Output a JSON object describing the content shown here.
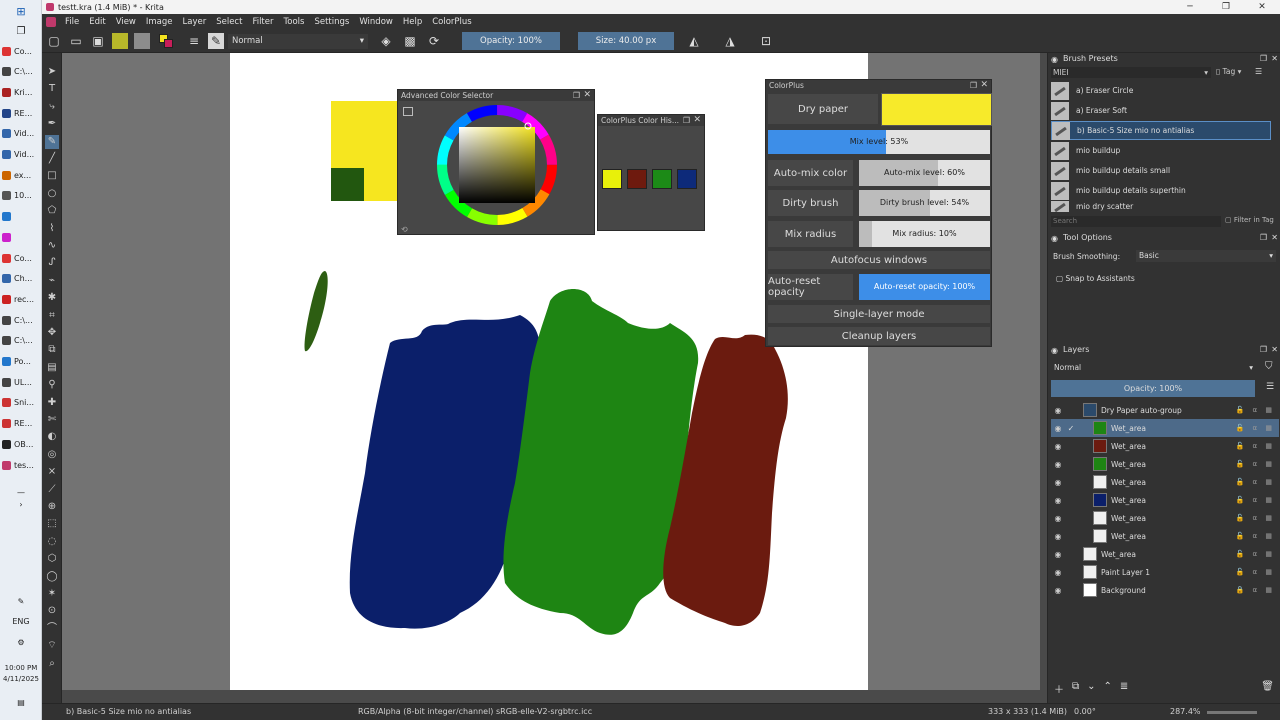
{
  "window": {
    "title": "testt.kra (1.4 MiB) * - Krita",
    "controls": [
      "─",
      "❐",
      "✕"
    ]
  },
  "taskbar": {
    "items": [
      "Co...",
      "C:\\...",
      "Kri...",
      "RE...",
      "Vid...",
      "Vid...",
      "ex...",
      "10...",
      "",
      "",
      "Co...",
      "Ch...",
      "rec...",
      "C:\\...",
      "C:\\...",
      "Po...",
      "UL...",
      "Sni...",
      "RE...",
      "OB...",
      "tes..."
    ],
    "lang": "ENG",
    "time": "10:00 PM",
    "date": "4/11/2025"
  },
  "menu": [
    "File",
    "Edit",
    "View",
    "Image",
    "Layer",
    "Select",
    "Filter",
    "Tools",
    "Settings",
    "Window",
    "Help",
    "ColorPlus"
  ],
  "toolbar": {
    "blend_mode": "Normal",
    "opacity": "Opacity: 100%",
    "size": "Size: 40.00 px"
  },
  "advanced_color_selector": {
    "title": "Advanced Color Selector"
  },
  "color_history": {
    "title": "ColorPlus Color His...",
    "swatches": [
      "#e8f00a",
      "#6e1a0e",
      "#1c8a17",
      "#0d2a7a"
    ]
  },
  "colorplus": {
    "title": "ColorPlus",
    "dry_paper": "Dry paper",
    "dry_color": "#f7ea2a",
    "mix_level": "Mix level: 53%",
    "mix_level_value": 0.53,
    "auto_mix_color": "Auto-mix color",
    "auto_mix_level": "Auto-mix level: 60%",
    "auto_mix_value": 0.6,
    "dirty_brush": "Dirty brush",
    "dirty_level": "Dirty brush level: 54%",
    "dirty_value": 0.54,
    "mix_radius": "Mix radius",
    "mix_radius_level": "Mix radius: 10%",
    "mix_radius_value": 0.1,
    "autofocus": "Autofocus windows",
    "auto_reset_opacity": "Auto-reset opacity",
    "auto_reset_level": "Auto-reset opacity: 100%",
    "single_layer": "Single-layer mode",
    "cleanup": "Cleanup layers"
  },
  "brush_presets": {
    "title": "Brush Presets",
    "filter_tag": "MIEI",
    "tag_label": "Tag",
    "items": [
      "a) Eraser Circle",
      "a) Eraser Soft",
      "b) Basic-5 Size mio no antialias",
      "mio buildup",
      "mio buildup details small",
      "mio buildup details superthin",
      "mio dry scatter"
    ],
    "search": "Search",
    "filter_in_tag": "Filter in Tag"
  },
  "tool_options": {
    "title": "Tool Options",
    "smoothing_label": "Brush Smoothing:",
    "smoothing_value": "Basic",
    "snap": "Snap to Assistants"
  },
  "layers": {
    "title": "Layers",
    "blend": "Normal",
    "opacity": "Opacity:  100%",
    "items": [
      "Dry Paper auto-group",
      "Wet_area",
      "Wet_area",
      "Wet_area",
      "Wet_area",
      "Wet_area",
      "Wet_area",
      "Wet_area",
      "Wet_area",
      "Paint Layer 1",
      "Background"
    ]
  },
  "status": {
    "brush": "b) Basic-5 Size mio no antialias",
    "color_space": "RGB/Alpha (8-bit integer/channel)  sRGB-elle-V2-srgbtrc.icc",
    "dims": "333 x 333 (1.4 MiB)",
    "rotation": "0.00°",
    "zoom": "287.4%"
  }
}
